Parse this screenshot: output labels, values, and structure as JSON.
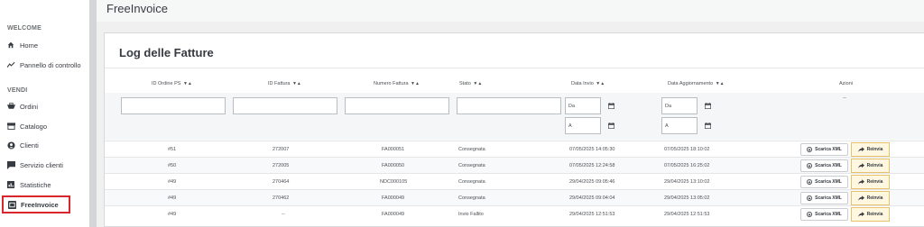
{
  "app": {
    "title": "FreeInvoice"
  },
  "sidebar": {
    "sections": [
      {
        "label": "WELCOME"
      },
      {
        "label": "VENDI"
      }
    ],
    "items": [
      {
        "label": "Home",
        "icon": "home-icon"
      },
      {
        "label": "Pannello di controllo",
        "icon": "trend-icon"
      },
      {
        "label": "Ordini",
        "icon": "cart-icon"
      },
      {
        "label": "Catalogo",
        "icon": "store-icon"
      },
      {
        "label": "Clienti",
        "icon": "user-circle-icon"
      },
      {
        "label": "Servizio clienti",
        "icon": "chat-icon"
      },
      {
        "label": "Statistiche",
        "icon": "chart-icon"
      },
      {
        "label": "FreeInvoice",
        "icon": "invoice-icon",
        "active": true
      }
    ]
  },
  "panel": {
    "title": "Log delle Fatture",
    "columns": [
      "ID Ordine PS",
      "ID Fattura",
      "Numero Fattura",
      "Stato",
      "Data Invio",
      "Data Aggiornamento",
      "Azioni"
    ],
    "sort_marker": "▼▲",
    "filters": {
      "date_from_placeholder": "Da",
      "date_to_placeholder": "A",
      "actions_placeholder": "--"
    },
    "rows": [
      {
        "order_id": "#51",
        "invoice_id": "272007",
        "invoice_number": "FA000051",
        "status": "Consegnata",
        "sent": "07/05/2025 14:05:30",
        "updated": "07/05/2025 18:10:02"
      },
      {
        "order_id": "#50",
        "invoice_id": "272005",
        "invoice_number": "FA000050",
        "status": "Consegnata",
        "sent": "07/05/2025 12:24:58",
        "updated": "07/05/2025 16:25:02"
      },
      {
        "order_id": "#49",
        "invoice_id": "270464",
        "invoice_number": "NDC000105",
        "status": "Consegnata",
        "sent": "29/04/2025 09:05:46",
        "updated": "29/04/2025 13:10:02"
      },
      {
        "order_id": "#49",
        "invoice_id": "270462",
        "invoice_number": "FA000049",
        "status": "Consegnata",
        "sent": "29/04/2025 09:04:04",
        "updated": "29/04/2025 13:05:02"
      },
      {
        "order_id": "#49",
        "invoice_id": "--",
        "invoice_number": "FA000049",
        "status": "Invio Fallito",
        "sent": "29/04/2025 12:51:53",
        "updated": "29/04/2025 12:51:53"
      }
    ],
    "actions": {
      "xml_label": "Scarica XML",
      "resend_label": "Reinvia"
    }
  },
  "colors": {
    "active_border": "#d9262c",
    "resend_bg": "#fff7e0",
    "resend_border": "#e8c16b"
  }
}
